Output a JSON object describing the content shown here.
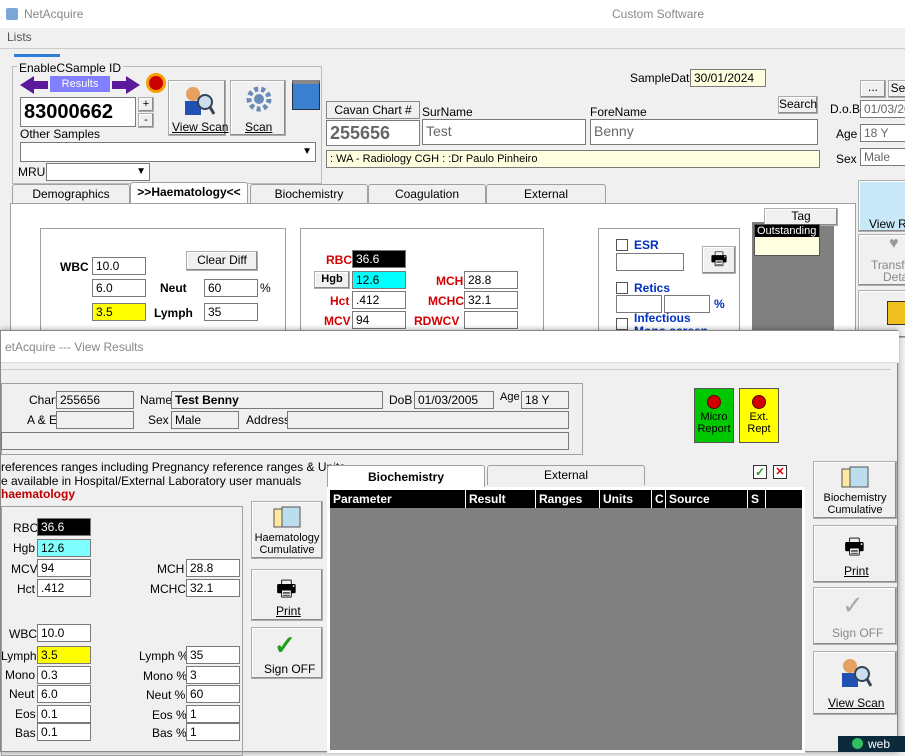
{
  "app": {
    "title": "NetAcquire",
    "vendor": "Custom Software",
    "menu_lists": "Lists"
  },
  "sample": {
    "group_label": "EnableCSample ID",
    "results_label": "Results",
    "sample_id": "83000662",
    "other_samples": "Other Samples",
    "mru_label": "MRU",
    "view_scan": "View Scan",
    "scan": "Scan",
    "plus": "+",
    "minus": "-",
    "sample_date_label": "SampleDate",
    "sample_date": "30/01/2024"
  },
  "patient": {
    "chart_label": "Cavan Chart #",
    "chart": "255656",
    "surname_label": "SurName",
    "surname": "Test",
    "forename_label": "ForeName",
    "forename": "Benny",
    "search": "Search",
    "location": ": WA - Radiology CGH : :Dr Paulo Pinheiro",
    "dob_label": "D.o.B",
    "dob": "01/03/20",
    "age_label": "Age",
    "age": "18 Y",
    "sex_label": "Sex",
    "sex": "Male",
    "ellipsis": "...",
    "se": "Se"
  },
  "main_tabs": [
    "Demographics",
    ">>Haematology<<",
    "Biochemistry",
    "Coagulation",
    "External"
  ],
  "haem": {
    "wbc_label": "WBC",
    "wbc": "10.0",
    "clear_diff": "Clear Diff",
    "neut_abs": "6.0",
    "neut_label": "Neut",
    "neut_pct": "60",
    "pct_sign": "%",
    "lymph_abs": "3.5",
    "lymph_label": "Lymph",
    "lymph_pct": "35",
    "rbc_label": "RBC",
    "rbc": "36.6",
    "hgb_label": "Hgb",
    "hgb": "12.6",
    "hct_label": "Hct",
    "hct": ".412",
    "mcv_label": "MCV",
    "mcv": "94",
    "mch_label": "MCH",
    "mch": "28.8",
    "mchc_label": "MCHC",
    "mchc": "32.1",
    "rdwcv_label": "RDWCV",
    "esr": "ESR",
    "retics": "Retics",
    "retics_pct": "%",
    "infectious": "Infectious",
    "mono_screen": "Mono screen",
    "tag": "Tag",
    "outstanding": "Outstanding"
  },
  "right_side": {
    "view_re": "View Re",
    "transfu": "Transfu",
    "deta": "Deta"
  },
  "view_results": {
    "title": "etAcquire --- View Results",
    "chart_label": "Chart",
    "chart": "255656",
    "name_label": "Name",
    "name": "Test Benny",
    "dob_label": "DoB",
    "dob": "01/03/2005",
    "age_label": "Age",
    "age": "18 Y",
    "ae_label": "A & E",
    "sex_label": "Sex",
    "sex": "Male",
    "address_label": "Address",
    "micro_report": [
      "Micro",
      "Report"
    ],
    "ext_rept": [
      "Ext.",
      "Rept"
    ],
    "note1": "references ranges including Pregnancy reference ranges & Units",
    "note2": "e available in Hospital/External Laboratory user manuals",
    "section": "haematology",
    "tabs": [
      "Biochemistry",
      "External"
    ],
    "table_headers": [
      "Parameter",
      "Result",
      "Ranges",
      "Units",
      "C",
      "Source",
      "S"
    ],
    "haem_cumulative": [
      "Haematology",
      "Cumulative"
    ],
    "print": "Print",
    "sign_off": "Sign OFF",
    "bio_cumulative": [
      "Biochemistry",
      "Cumulative"
    ],
    "view_scan": "View Scan",
    "check_mark": "✓",
    "close_mark": "✕"
  },
  "vr_values": {
    "rbc_label": "RBC",
    "rbc": "36.6",
    "hgb_label": "Hgb",
    "hgb": "12.6",
    "mcv_label": "MCV",
    "mcv": "94",
    "hct_label": "Hct",
    "hct": ".412",
    "mch_label": "MCH",
    "mch": "28.8",
    "mchc_label": "MCHC",
    "mchc": "32.1",
    "wbc_label": "WBC",
    "wbc": "10.0",
    "lymph_label": "Lymph",
    "lymph": "3.5",
    "mono_label": "Mono",
    "mono": "0.3",
    "neut_label": "Neut",
    "neut": "6.0",
    "eos_label": "Eos",
    "eos": "0.1",
    "bas_label": "Bas",
    "bas": "0.1",
    "lymph_pct_label": "Lymph %",
    "lymph_pct": "35",
    "mono_pct_label": "Mono %",
    "mono_pct": "3",
    "neut_pct_label": "Neut %",
    "neut_pct": "60",
    "eos_pct_label": "Eos %",
    "eos_pct": "1",
    "bas_pct_label": "Bas %",
    "bas_pct": "1"
  },
  "colors": {
    "highlight_yellow": "#ffff00",
    "highlight_cyan": "#80ffff",
    "grid_gray": "#808080",
    "header_black": "#000000",
    "green_button": "#00c800"
  },
  "taskbar_text": "web"
}
